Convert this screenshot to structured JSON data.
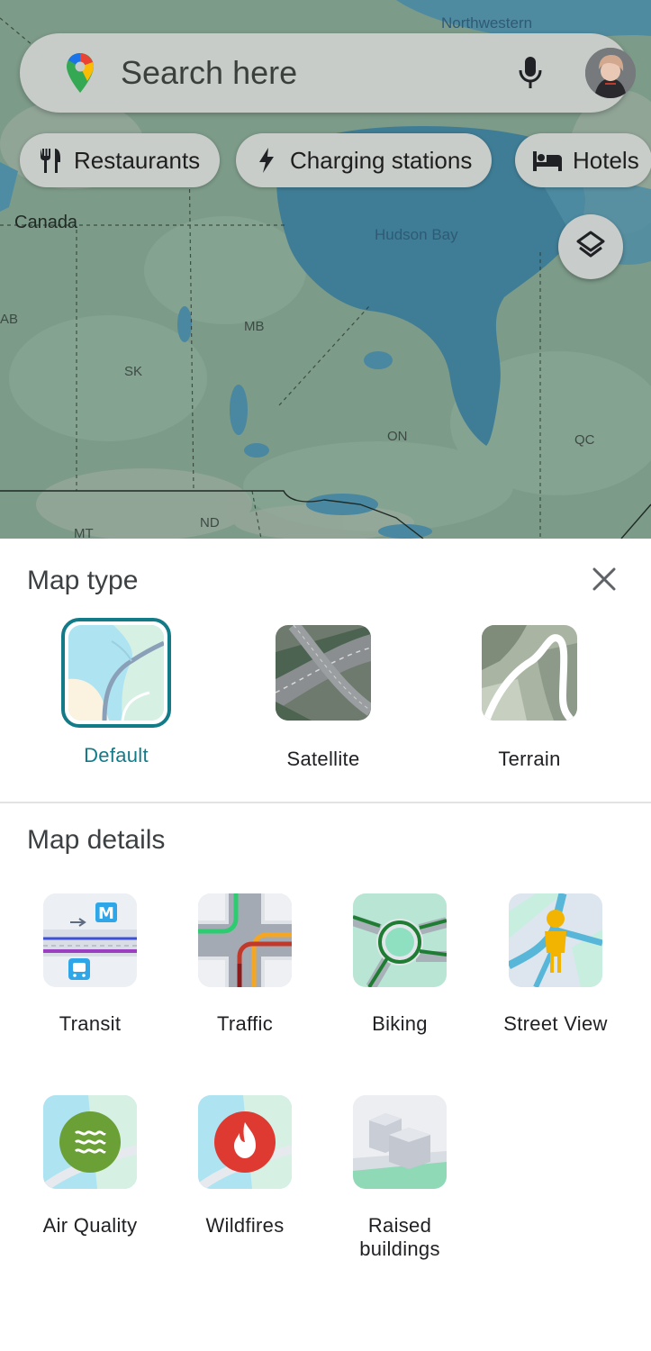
{
  "map": {
    "labels": {
      "country": "Canada",
      "hudson_bay": "Hudson Bay",
      "northwestern": "Northwestern",
      "ab": "AB",
      "mb": "MB",
      "sk": "SK",
      "on": "ON",
      "qc": "QC",
      "nd": "ND",
      "mt": "MT"
    },
    "search_placeholder": "Search here",
    "chips": [
      {
        "label": "Restaurants",
        "icon": "fork-knife-icon"
      },
      {
        "label": "Charging stations",
        "icon": "lightning-icon"
      },
      {
        "label": "Hotels",
        "icon": "bed-icon"
      }
    ]
  },
  "sheet": {
    "map_type_title": "Map type",
    "map_types": [
      {
        "label": "Default",
        "selected": true
      },
      {
        "label": "Satellite",
        "selected": false
      },
      {
        "label": "Terrain",
        "selected": false
      }
    ],
    "map_details_title": "Map details",
    "details": [
      {
        "label": "Transit"
      },
      {
        "label": "Traffic"
      },
      {
        "label": "Biking"
      },
      {
        "label": "Street View"
      },
      {
        "label": "Air Quality"
      },
      {
        "label": "Wildfires"
      },
      {
        "label": "Raised buildings"
      }
    ]
  },
  "colors": {
    "accent": "#137b88",
    "map_water": "#3f7d96",
    "map_land": "#7f9c8b"
  }
}
